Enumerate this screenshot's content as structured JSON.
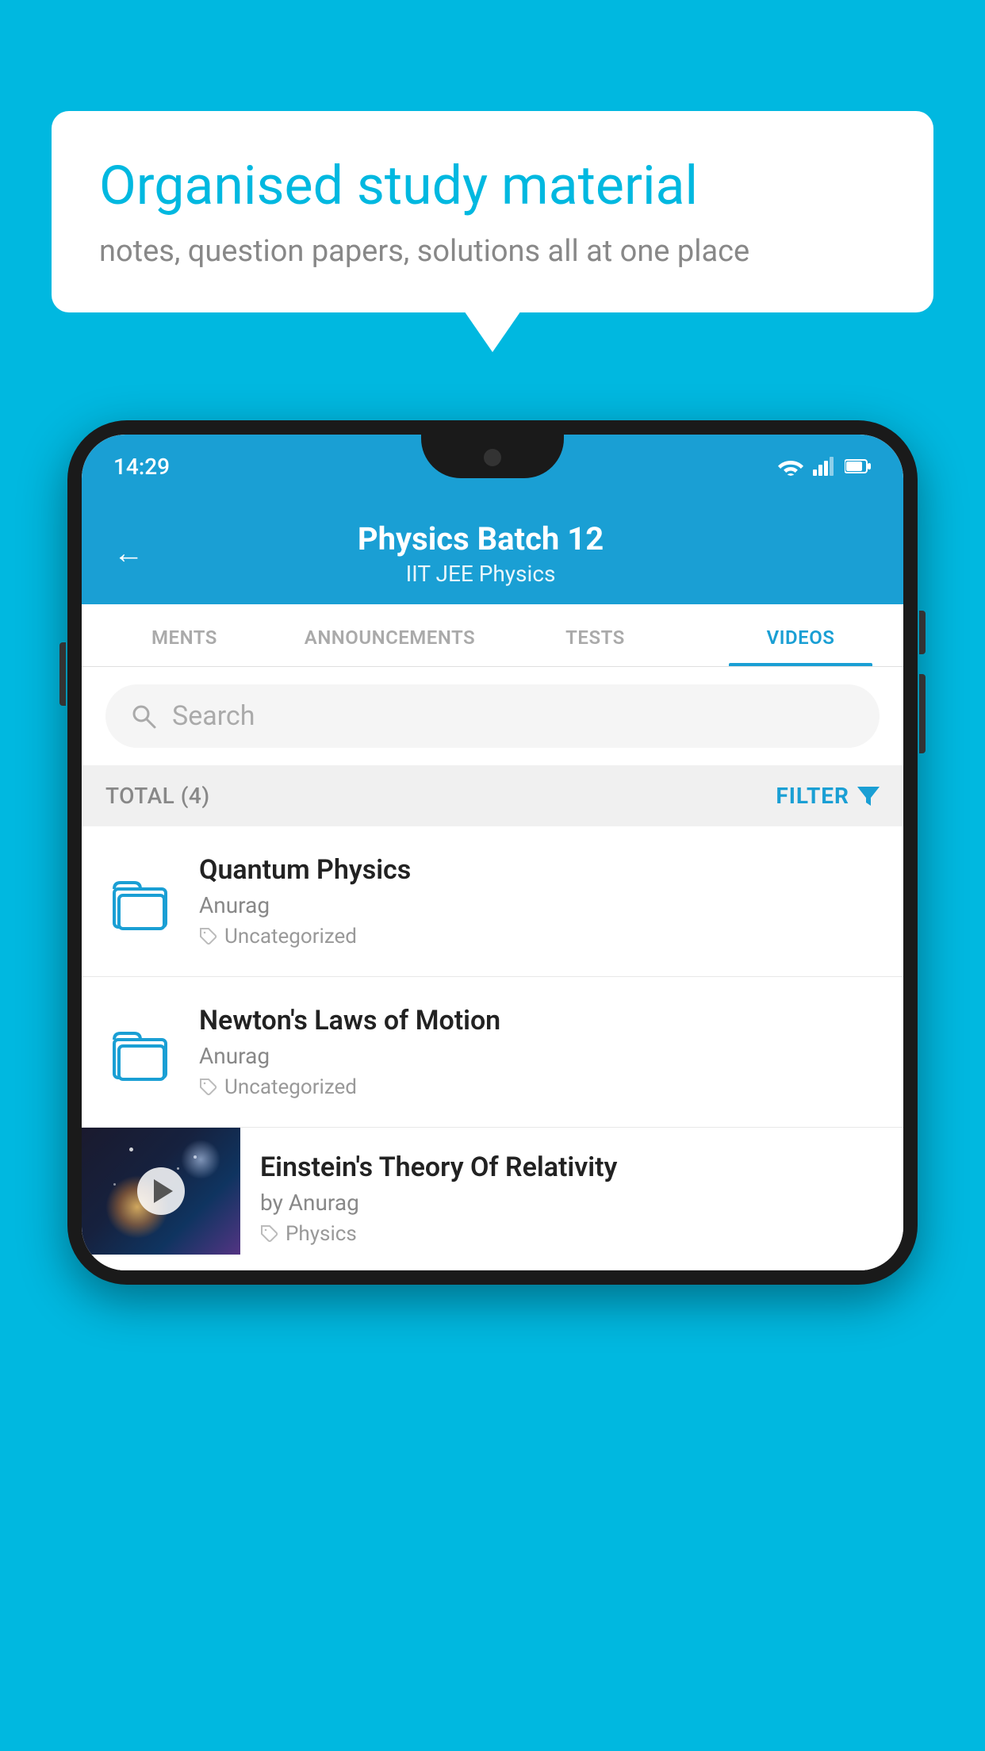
{
  "background_color": "#00b8e0",
  "speech_bubble": {
    "title": "Organised study material",
    "subtitle": "notes, question papers, solutions all at one place"
  },
  "status_bar": {
    "time": "14:29",
    "icons": [
      "wifi",
      "signal",
      "battery"
    ]
  },
  "app_header": {
    "back_label": "←",
    "title": "Physics Batch 12",
    "subtitle": "IIT JEE   Physics"
  },
  "tabs": [
    {
      "label": "MENTS",
      "active": false
    },
    {
      "label": "ANNOUNCEMENTS",
      "active": false
    },
    {
      "label": "TESTS",
      "active": false
    },
    {
      "label": "VIDEOS",
      "active": true
    }
  ],
  "search": {
    "placeholder": "Search"
  },
  "filter_bar": {
    "total_label": "TOTAL (4)",
    "filter_label": "FILTER"
  },
  "videos": [
    {
      "id": 1,
      "title": "Quantum Physics",
      "author": "Anurag",
      "tag": "Uncategorized",
      "has_thumbnail": false
    },
    {
      "id": 2,
      "title": "Newton's Laws of Motion",
      "author": "Anurag",
      "tag": "Uncategorized",
      "has_thumbnail": false
    },
    {
      "id": 3,
      "title": "Einstein's Theory Of Relativity",
      "author": "by Anurag",
      "tag": "Physics",
      "has_thumbnail": true
    }
  ]
}
